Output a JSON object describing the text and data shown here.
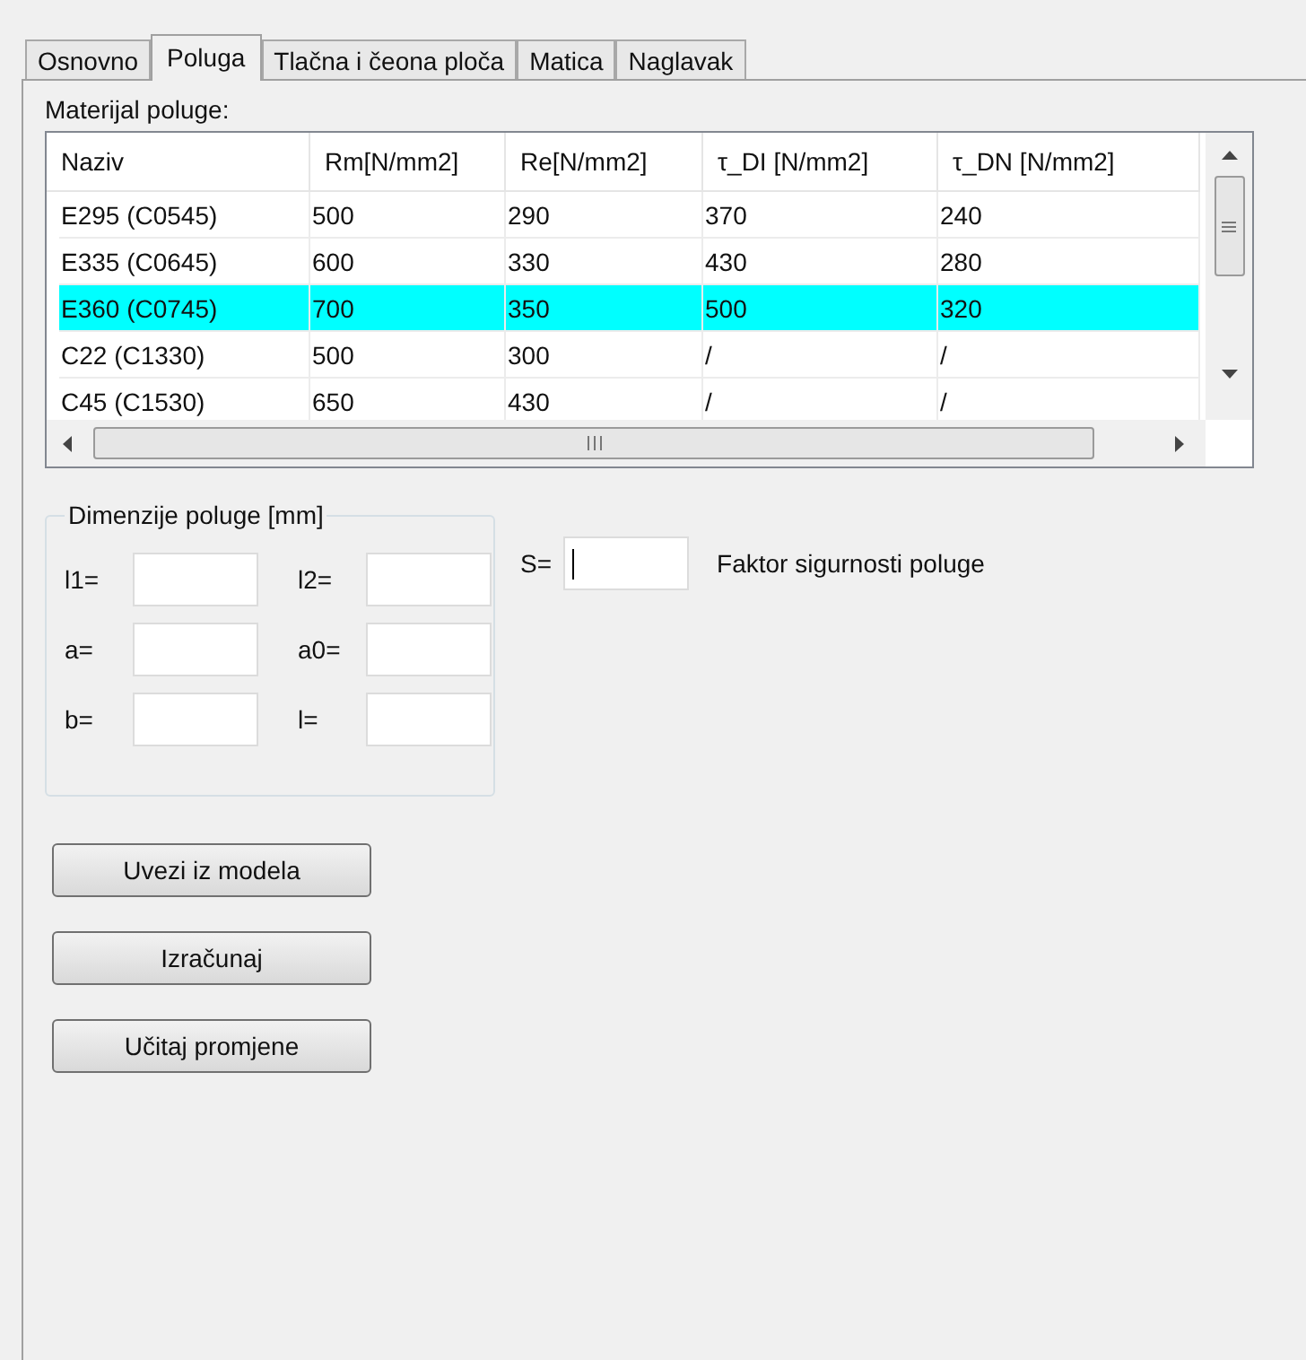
{
  "tabs": [
    {
      "label": "Osnovno",
      "selected": false
    },
    {
      "label": "Poluga",
      "selected": true
    },
    {
      "label": "Tlačna i čeona ploča",
      "selected": false
    },
    {
      "label": "Matica",
      "selected": false
    },
    {
      "label": "Naglavak",
      "selected": false
    }
  ],
  "material_label": "Materijal poluge:",
  "table": {
    "columns": [
      "Naziv",
      "Rm[N/mm2]",
      "Re[N/mm2]",
      "τ_DI [N/mm2]",
      "τ_DN [N/mm2]"
    ],
    "rows": [
      {
        "cells": [
          "E295 (C0545)",
          "500",
          "290",
          "370",
          "240"
        ],
        "selected": false
      },
      {
        "cells": [
          "E335 (C0645)",
          "600",
          "330",
          "430",
          "280"
        ],
        "selected": false
      },
      {
        "cells": [
          "E360 (C0745)",
          "700",
          "350",
          "500",
          "320"
        ],
        "selected": true
      },
      {
        "cells": [
          "C22 (C1330)",
          "500",
          "300",
          "/",
          "/"
        ],
        "selected": false
      },
      {
        "cells": [
          "C45 (C1530)",
          "650",
          "430",
          "/",
          "/"
        ],
        "selected": false
      }
    ]
  },
  "dimensions": {
    "title": "Dimenzije poluge [mm]",
    "fields": [
      {
        "label": "l1="
      },
      {
        "label": "l2="
      },
      {
        "label": "a="
      },
      {
        "label": "a0="
      },
      {
        "label": "b="
      },
      {
        "label": "l="
      }
    ]
  },
  "safety": {
    "label": "S=",
    "focused": true,
    "description": "Faktor sigurnosti poluge"
  },
  "buttons": [
    "Uvezi iz modela",
    "Izračunaj",
    "Učitaj promjene"
  ]
}
